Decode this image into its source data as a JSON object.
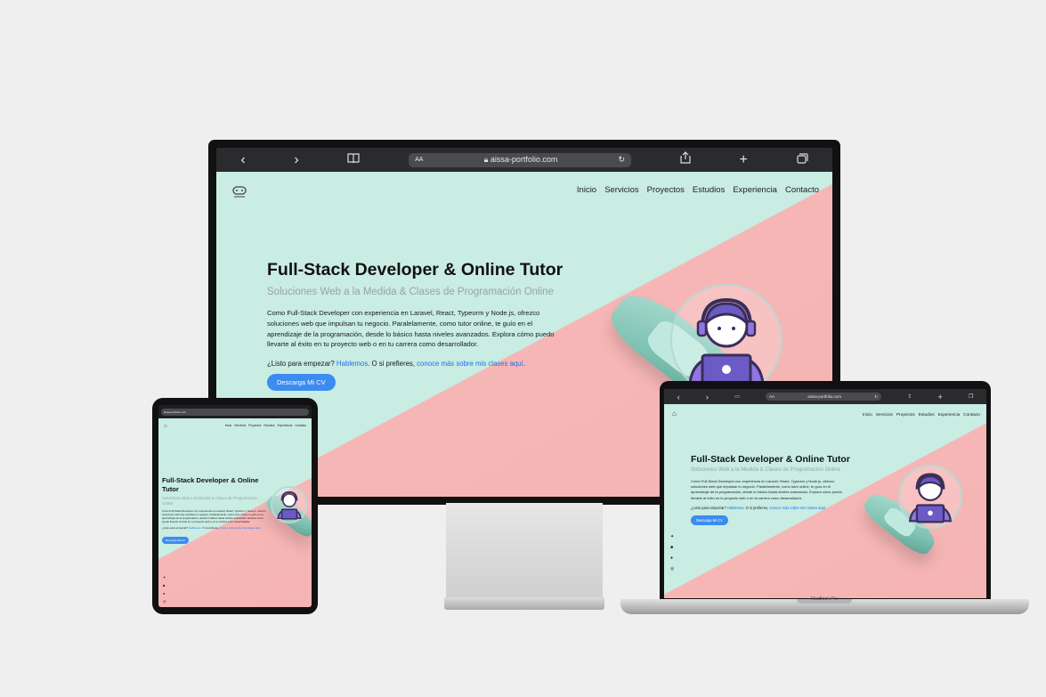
{
  "browser": {
    "url": "aissa-portfolio.com",
    "aa_label": "AA",
    "back_icon": "chevron-left-icon",
    "forward_icon": "chevron-right-icon",
    "bookmarks_icon": "book-icon",
    "reload_icon": "reload-icon",
    "share_icon": "share-icon",
    "new_tab_icon": "plus-icon",
    "tabs_icon": "tabs-icon"
  },
  "site": {
    "nav": [
      "Inicio",
      "Servicios",
      "Proyectos",
      "Estudios",
      "Experiencia",
      "Contacto"
    ],
    "title": "Full-Stack Developer & Online Tutor",
    "subtitle": "Soluciones Web a la Medida & Clases de Programación Online",
    "description": "Como Full-Stack Developer con experiencia en Laravel, React, Typeorm y Node.js, ofrezco soluciones web que impulsan tu negocio. Paralelamente, como tutor online, te guío en el aprendizaje de la programación, desde lo básico hasta niveles avanzados. Explora cómo puedo llevarte al éxito en tu proyecto web o en tu carrera como desarrollador.",
    "cta_prefix": "¿Listo para empezar? ",
    "cta_link1": "Hablemos",
    "cta_mid": ". O si prefieres, ",
    "cta_link2": "conoce más sobre mis clases aquí",
    "cta_suffix": ".",
    "cv_button": "Descarga Mi CV",
    "socials": [
      "twitter-icon",
      "linkedin-icon",
      "github-icon",
      "instagram-icon"
    ]
  },
  "laptop_label": "MacBook Pro",
  "colors": {
    "mint": "#c9ece3",
    "pink": "#f5b4b4",
    "accent": "#3b8cf0",
    "link": "#1a73e8",
    "avatar_purple": "#8f76e0",
    "avatar_dark": "#3a2e5a"
  }
}
